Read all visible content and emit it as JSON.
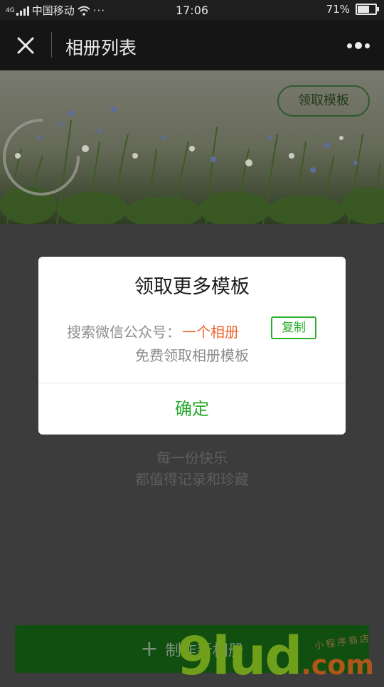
{
  "status_bar": {
    "network": "4G",
    "carrier": "中国移动",
    "time": "17:06",
    "battery_percent": "71%",
    "battery_level": 0.71
  },
  "nav": {
    "title": "相册列表",
    "close_icon": "close-icon",
    "more_icon": "more-dots-icon"
  },
  "banner": {
    "template_button": "领取模板"
  },
  "empty_state": {
    "line1": "每一份快乐",
    "line2": "都值得记录和珍藏"
  },
  "create_button": {
    "label": "制作新相册",
    "icon": "plus-icon"
  },
  "watermark": {
    "main": "9lud",
    "domain": ".com",
    "small": "小程序商店"
  },
  "dialog": {
    "title": "领取更多模板",
    "prefix": "搜索微信公众号：",
    "account_name": "一个相册",
    "copy_button": "复制",
    "subtitle": "免费领取相册模板",
    "confirm_button": "确定"
  },
  "colors": {
    "accent_green": "#25a92b",
    "highlight_orange": "#f0632a",
    "create_button_bg": "#104f10"
  }
}
